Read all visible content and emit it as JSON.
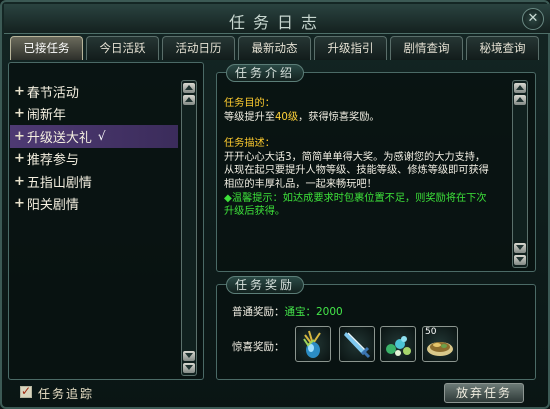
{
  "window": {
    "title": "任务日志",
    "close_label": "✕"
  },
  "tabs": [
    {
      "label": "已接任务",
      "active": true
    },
    {
      "label": "今日活跃",
      "active": false
    },
    {
      "label": "活动日历",
      "active": false
    },
    {
      "label": "最新动态",
      "active": false
    },
    {
      "label": "升级指引",
      "active": false
    },
    {
      "label": "剧情查询",
      "active": false
    },
    {
      "label": "秘境查询",
      "active": false
    }
  ],
  "quest_list": {
    "plus": "+",
    "items": [
      {
        "label": "春节活动"
      },
      {
        "label": "闹新年"
      },
      {
        "label": "升级送大礼",
        "selected": true,
        "check": "√"
      },
      {
        "label": "推荐参与"
      },
      {
        "label": "五指山剧情"
      },
      {
        "label": "阳关剧情"
      }
    ]
  },
  "description": {
    "panel_title": "任务介绍",
    "goal_label": "任务目的：",
    "goal_prefix": "等级提升至",
    "goal_level": "40级",
    "goal_suffix": "，获得惊喜奖励。",
    "desc_label": "任务描述：",
    "desc_text": "开开心心大话3，简简单单得大奖。为感谢您的大力支持，从现在起只要提升人物等级、技能等级、修炼等级即可获得相应的丰厚礼品，一起来畅玩吧！",
    "tip_text": "◆温馨提示：如达成要求时包裹位置不足，则奖励将在下次升级后获得。"
  },
  "rewards": {
    "panel_title": "任务奖励",
    "normal_label": "普通奖励：",
    "normal_value": "通宝：2000",
    "surprise_label": "惊喜奖励：",
    "items": [
      {
        "icon": "herb-bundle-icon"
      },
      {
        "icon": "crystal-sword-icon"
      },
      {
        "icon": "orbs-cluster-icon"
      },
      {
        "icon": "food-plate-icon",
        "count": "50"
      }
    ]
  },
  "footer": {
    "track_checked": true,
    "track_label": "任务追踪",
    "abandon_label": "放弃任务"
  }
}
